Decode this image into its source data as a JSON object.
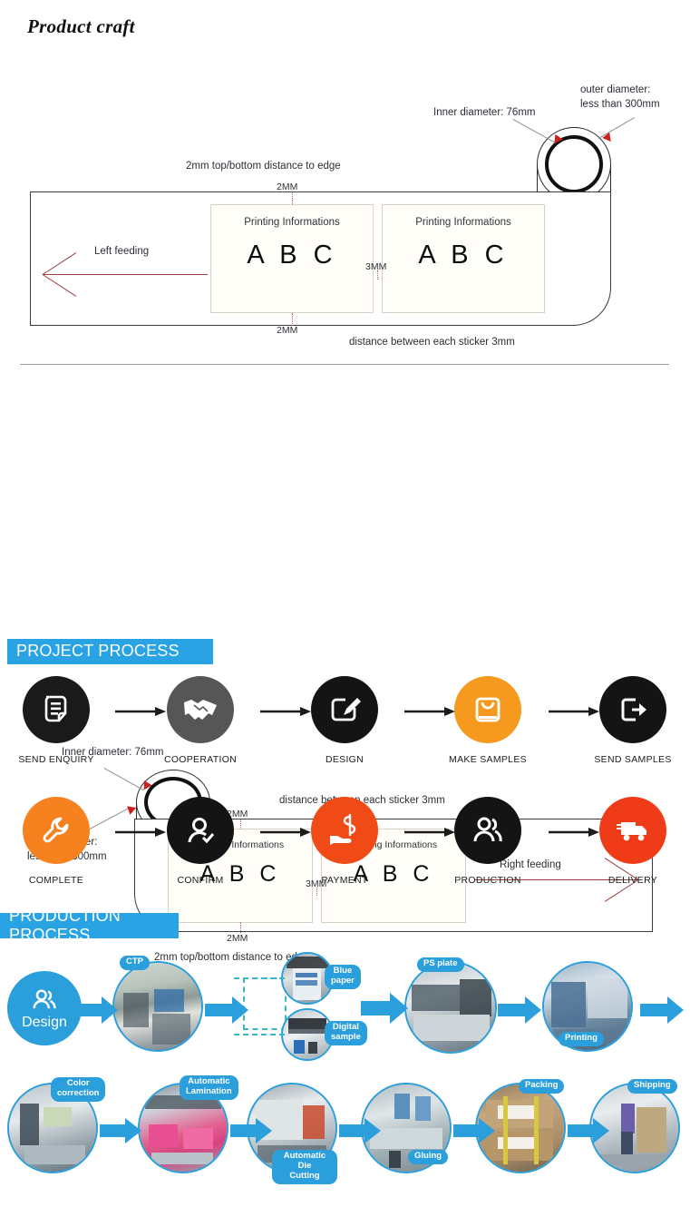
{
  "page": {
    "title": "Product craft"
  },
  "diagram_left_feed": {
    "inner_diameter_label": "Inner diameter:  76mm",
    "outer_diameter_label_line1": "outer diameter:",
    "outer_diameter_label_line2": "less than 300mm",
    "top_edge_note": "2mm top/bottom distance to edge",
    "top_dim": "2MM",
    "bottom_dim": "2MM",
    "gap_dim": "3MM",
    "sticker_gap_note": "distance between each sticker 3mm",
    "feeding_label": "Left feeding",
    "stickers": [
      {
        "title": "Printing Informations",
        "abc": "A B C"
      },
      {
        "title": "Printing Informations",
        "abc": "A B C"
      }
    ]
  },
  "diagram_right_feed": {
    "inner_diameter_label": "Inner diameter:  76mm",
    "outer_diameter_label_line1": "outer diameter:",
    "outer_diameter_label_line2": "less than 300mm",
    "sticker_gap_note": "distance between each sticker 3mm",
    "top_dim": "2MM",
    "bottom_dim": "2MM",
    "gap_dim": "3MM",
    "bottom_edge_note": "2mm top/bottom distance to edge",
    "feeding_label": "Right feeding",
    "stickers": [
      {
        "title": "Printing Informations",
        "abc": "A B C"
      },
      {
        "title": "Printing Informations",
        "abc": "A B C"
      }
    ]
  },
  "project_process": {
    "banner": "PROJECT PROCESS",
    "accent_blue": "#29a3e3",
    "row1": [
      {
        "label": "SEND ENQUIRY",
        "icon": "document-icon",
        "color": "#1a1a1a"
      },
      {
        "label": "COOPERATION",
        "icon": "handshake-icon",
        "color": "#565656"
      },
      {
        "label": "DESIGN",
        "icon": "pencil-edit-icon",
        "color": "#141414"
      },
      {
        "label": "MAKE SAMPLES",
        "icon": "shopping-bag-icon",
        "color": "#f59a1e"
      },
      {
        "label": "SEND SAMPLES",
        "icon": "export-arrow-icon",
        "color": "#141414"
      }
    ],
    "row2": [
      {
        "label": "COMPLETE",
        "icon": "wrench-icon",
        "color": "#f5821f"
      },
      {
        "label": "CONFIRM",
        "icon": "user-check-icon",
        "color": "#141414"
      },
      {
        "label": "PAYMENT",
        "icon": "hand-money-icon",
        "color": "#f04a16"
      },
      {
        "label": "PRODUCTION",
        "icon": "users-group-icon",
        "color": "#141414"
      },
      {
        "label": "DELIVERY",
        "icon": "truck-icon",
        "color": "#ef3b18"
      }
    ]
  },
  "production_process": {
    "banner": "PRODUCTION PROCESS",
    "design_label": "Design",
    "design_icon": "users-group-icon",
    "row1_tags": [
      "CTP",
      "Blue\npaper",
      "Digital\nsample",
      "PS plate",
      "Printing"
    ],
    "row2_tags": [
      "Color\ncorrection",
      "Automatic\nLamination",
      "Automatic Die\nCutting",
      "Gluing",
      "Packing",
      "Shipping"
    ]
  }
}
